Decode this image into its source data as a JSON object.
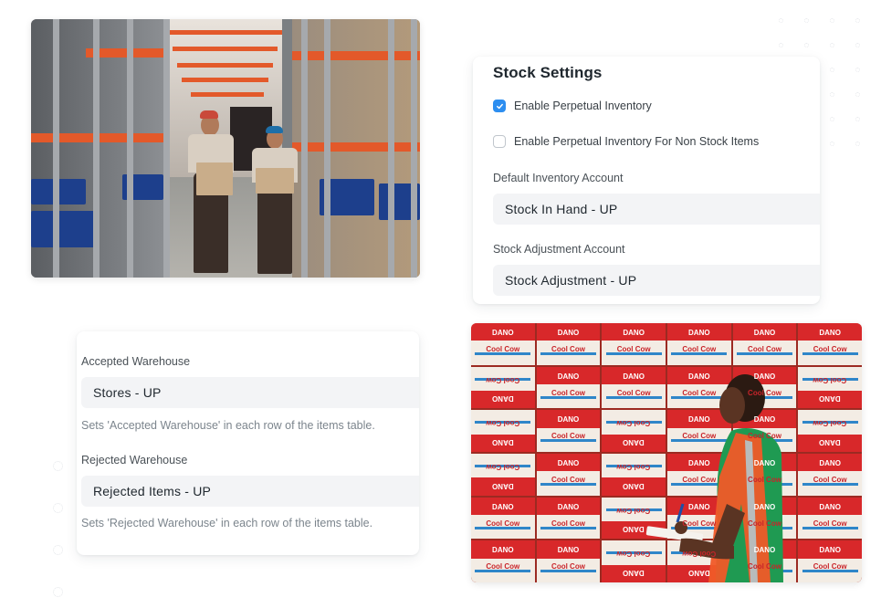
{
  "stock_settings": {
    "title": "Stock Settings",
    "checkboxes": [
      {
        "label": "Enable Perpetual Inventory",
        "checked": true
      },
      {
        "label": "Enable Perpetual Inventory For Non Stock Items",
        "checked": false
      }
    ],
    "fields": [
      {
        "label": "Default Inventory Account",
        "value": "Stock In Hand - UP"
      },
      {
        "label": "Stock Adjustment Account",
        "value": "Stock Adjustment - UP"
      }
    ],
    "accent_color": "#2d8ef0"
  },
  "warehouse_settings": {
    "fields": [
      {
        "label": "Accepted Warehouse",
        "value": "Stores - UP",
        "hint": "Sets 'Accepted Warehouse' in each row of the items table."
      },
      {
        "label": "Rejected Warehouse",
        "value": "Rejected Items - UP",
        "hint": "Sets 'Rejected Warehouse' in each row of the items table."
      }
    ]
  },
  "photos": {
    "warehouse": {
      "alt": "Two warehouse workers carrying cardboard boxes between orange racks"
    },
    "boxes": {
      "alt": "Worker in green shirt and orange vest checking stacked boxes with a clipboard",
      "box_brand": "DANO",
      "box_product": "Cool Cow"
    }
  }
}
